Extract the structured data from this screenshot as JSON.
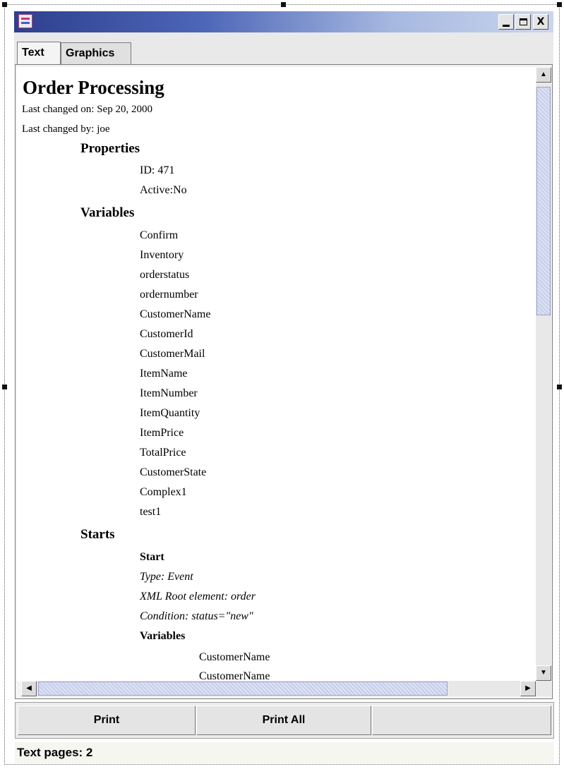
{
  "window": {
    "title": "",
    "controls": {
      "minimize": "_",
      "maximize": "□",
      "close": "X"
    }
  },
  "tabs": [
    {
      "label": "Text",
      "active": true
    },
    {
      "label": "Graphics",
      "active": false
    }
  ],
  "document": {
    "title": "Order Processing",
    "last_changed_on": "Last changed on: Sep 20, 2000",
    "last_changed_by": "Last changed by: joe",
    "sections": {
      "properties": {
        "heading": "Properties",
        "items": [
          "ID: 471",
          "Active:No"
        ]
      },
      "variables": {
        "heading": "Variables",
        "items": [
          "Confirm",
          "Inventory",
          "orderstatus",
          "ordernumber",
          "CustomerName",
          "CustomerId",
          "CustomerMail",
          "ItemName",
          "ItemNumber",
          "ItemQuantity",
          "ItemPrice",
          "TotalPrice",
          "CustomerState",
          "Complex1",
          "test1"
        ]
      },
      "starts": {
        "heading": "Starts",
        "start": {
          "heading": "Start",
          "type": "Type: Event",
          "xml_root": "XML Root element: order",
          "condition": "Condition:  status=\"new\"",
          "variables_heading": "Variables",
          "variables": [
            "CustomerName",
            "CustomerName"
          ]
        }
      }
    }
  },
  "buttons": {
    "print": "Print",
    "print_all": "Print All"
  },
  "status": {
    "text": "Text pages: 2"
  },
  "icons": {
    "app": "app-icon",
    "scroll_up": "▲",
    "scroll_down": "▼",
    "scroll_left": "◀",
    "scroll_right": "▶"
  },
  "colors": {
    "titlebar_start": "#2e3f8e",
    "titlebar_end": "#cbd6ee",
    "scroll_thumb": "#c6cdea"
  }
}
